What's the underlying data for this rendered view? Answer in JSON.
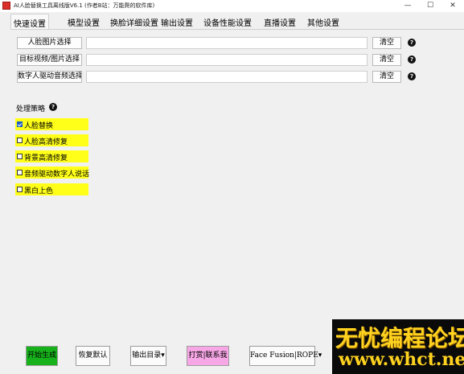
{
  "window": {
    "title": "AI人脸替换工具离线版V6.1  (作者B站：万能爬的软件库)",
    "minimize": "—",
    "maximize": "☐",
    "close": "✕"
  },
  "tabs": [
    {
      "label": "快速设置",
      "active": true
    },
    {
      "label": "模型设置"
    },
    {
      "label": "换脸详细设置"
    },
    {
      "label": "输出设置"
    },
    {
      "label": "设备性能设置"
    },
    {
      "label": "直播设置"
    },
    {
      "label": "其他设置"
    }
  ],
  "inputs": [
    {
      "button": "人脸图片选择",
      "value": "",
      "clear": "清空",
      "help": "?"
    },
    {
      "button": "目标视频/图片选择",
      "value": "",
      "clear": "清空",
      "help": "?"
    },
    {
      "button": "数字人驱动音频选择",
      "value": "",
      "clear": "清空",
      "help": "?"
    }
  ],
  "strategy": {
    "label": "处理策略",
    "help": "?",
    "highlight_color": "#ffff1a",
    "options": [
      {
        "label": "人脸替换",
        "checked": true
      },
      {
        "label": "人脸高清修复",
        "checked": false
      },
      {
        "label": "背景高清修复",
        "checked": false
      },
      {
        "label": "音频驱动数字人说话",
        "checked": false
      },
      {
        "label": "黑白上色",
        "checked": false
      }
    ]
  },
  "bottom_buttons": {
    "start": {
      "label": "开始生成",
      "color": "#17b21b"
    },
    "reset": {
      "label": "恢复默认"
    },
    "output_dir": {
      "label": "输出目录▾"
    },
    "donate": {
      "label": "打赏|联系我",
      "color": "#f7a6e6"
    },
    "engine": {
      "label": "Face Fusion|ROPE▾"
    }
  },
  "watermark": {
    "line1": "无忧编程论坛",
    "line2": "www.whct.net",
    "color": "#ffd21f"
  }
}
